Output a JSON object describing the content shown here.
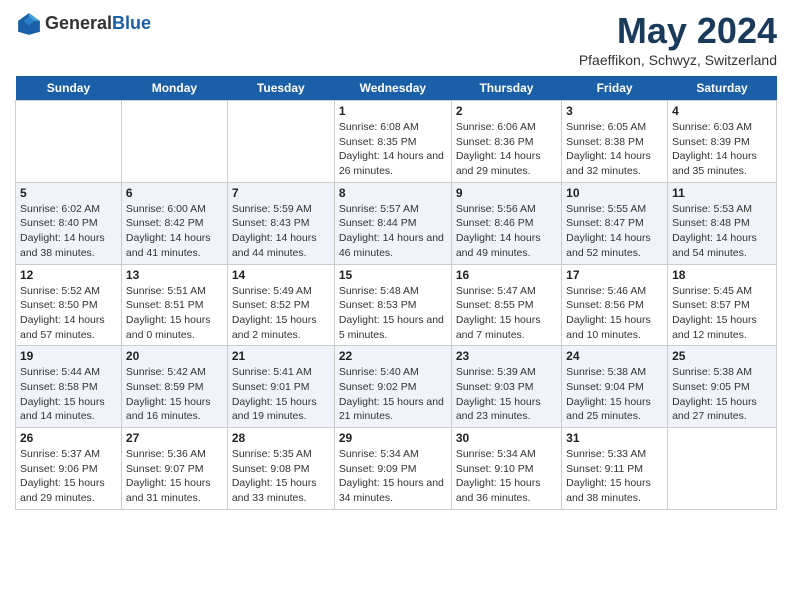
{
  "header": {
    "logo_general": "General",
    "logo_blue": "Blue",
    "month": "May 2024",
    "location": "Pfaeffikon, Schwyz, Switzerland"
  },
  "days_of_week": [
    "Sunday",
    "Monday",
    "Tuesday",
    "Wednesday",
    "Thursday",
    "Friday",
    "Saturday"
  ],
  "weeks": [
    [
      {
        "date": "",
        "text": ""
      },
      {
        "date": "",
        "text": ""
      },
      {
        "date": "",
        "text": ""
      },
      {
        "date": "1",
        "text": "Sunrise: 6:08 AM\nSunset: 8:35 PM\nDaylight: 14 hours and 26 minutes."
      },
      {
        "date": "2",
        "text": "Sunrise: 6:06 AM\nSunset: 8:36 PM\nDaylight: 14 hours and 29 minutes."
      },
      {
        "date": "3",
        "text": "Sunrise: 6:05 AM\nSunset: 8:38 PM\nDaylight: 14 hours and 32 minutes."
      },
      {
        "date": "4",
        "text": "Sunrise: 6:03 AM\nSunset: 8:39 PM\nDaylight: 14 hours and 35 minutes."
      }
    ],
    [
      {
        "date": "5",
        "text": "Sunrise: 6:02 AM\nSunset: 8:40 PM\nDaylight: 14 hours and 38 minutes."
      },
      {
        "date": "6",
        "text": "Sunrise: 6:00 AM\nSunset: 8:42 PM\nDaylight: 14 hours and 41 minutes."
      },
      {
        "date": "7",
        "text": "Sunrise: 5:59 AM\nSunset: 8:43 PM\nDaylight: 14 hours and 44 minutes."
      },
      {
        "date": "8",
        "text": "Sunrise: 5:57 AM\nSunset: 8:44 PM\nDaylight: 14 hours and 46 minutes."
      },
      {
        "date": "9",
        "text": "Sunrise: 5:56 AM\nSunset: 8:46 PM\nDaylight: 14 hours and 49 minutes."
      },
      {
        "date": "10",
        "text": "Sunrise: 5:55 AM\nSunset: 8:47 PM\nDaylight: 14 hours and 52 minutes."
      },
      {
        "date": "11",
        "text": "Sunrise: 5:53 AM\nSunset: 8:48 PM\nDaylight: 14 hours and 54 minutes."
      }
    ],
    [
      {
        "date": "12",
        "text": "Sunrise: 5:52 AM\nSunset: 8:50 PM\nDaylight: 14 hours and 57 minutes."
      },
      {
        "date": "13",
        "text": "Sunrise: 5:51 AM\nSunset: 8:51 PM\nDaylight: 15 hours and 0 minutes."
      },
      {
        "date": "14",
        "text": "Sunrise: 5:49 AM\nSunset: 8:52 PM\nDaylight: 15 hours and 2 minutes."
      },
      {
        "date": "15",
        "text": "Sunrise: 5:48 AM\nSunset: 8:53 PM\nDaylight: 15 hours and 5 minutes."
      },
      {
        "date": "16",
        "text": "Sunrise: 5:47 AM\nSunset: 8:55 PM\nDaylight: 15 hours and 7 minutes."
      },
      {
        "date": "17",
        "text": "Sunrise: 5:46 AM\nSunset: 8:56 PM\nDaylight: 15 hours and 10 minutes."
      },
      {
        "date": "18",
        "text": "Sunrise: 5:45 AM\nSunset: 8:57 PM\nDaylight: 15 hours and 12 minutes."
      }
    ],
    [
      {
        "date": "19",
        "text": "Sunrise: 5:44 AM\nSunset: 8:58 PM\nDaylight: 15 hours and 14 minutes."
      },
      {
        "date": "20",
        "text": "Sunrise: 5:42 AM\nSunset: 8:59 PM\nDaylight: 15 hours and 16 minutes."
      },
      {
        "date": "21",
        "text": "Sunrise: 5:41 AM\nSunset: 9:01 PM\nDaylight: 15 hours and 19 minutes."
      },
      {
        "date": "22",
        "text": "Sunrise: 5:40 AM\nSunset: 9:02 PM\nDaylight: 15 hours and 21 minutes."
      },
      {
        "date": "23",
        "text": "Sunrise: 5:39 AM\nSunset: 9:03 PM\nDaylight: 15 hours and 23 minutes."
      },
      {
        "date": "24",
        "text": "Sunrise: 5:38 AM\nSunset: 9:04 PM\nDaylight: 15 hours and 25 minutes."
      },
      {
        "date": "25",
        "text": "Sunrise: 5:38 AM\nSunset: 9:05 PM\nDaylight: 15 hours and 27 minutes."
      }
    ],
    [
      {
        "date": "26",
        "text": "Sunrise: 5:37 AM\nSunset: 9:06 PM\nDaylight: 15 hours and 29 minutes."
      },
      {
        "date": "27",
        "text": "Sunrise: 5:36 AM\nSunset: 9:07 PM\nDaylight: 15 hours and 31 minutes."
      },
      {
        "date": "28",
        "text": "Sunrise: 5:35 AM\nSunset: 9:08 PM\nDaylight: 15 hours and 33 minutes."
      },
      {
        "date": "29",
        "text": "Sunrise: 5:34 AM\nSunset: 9:09 PM\nDaylight: 15 hours and 34 minutes."
      },
      {
        "date": "30",
        "text": "Sunrise: 5:34 AM\nSunset: 9:10 PM\nDaylight: 15 hours and 36 minutes."
      },
      {
        "date": "31",
        "text": "Sunrise: 5:33 AM\nSunset: 9:11 PM\nDaylight: 15 hours and 38 minutes."
      },
      {
        "date": "",
        "text": ""
      }
    ]
  ]
}
